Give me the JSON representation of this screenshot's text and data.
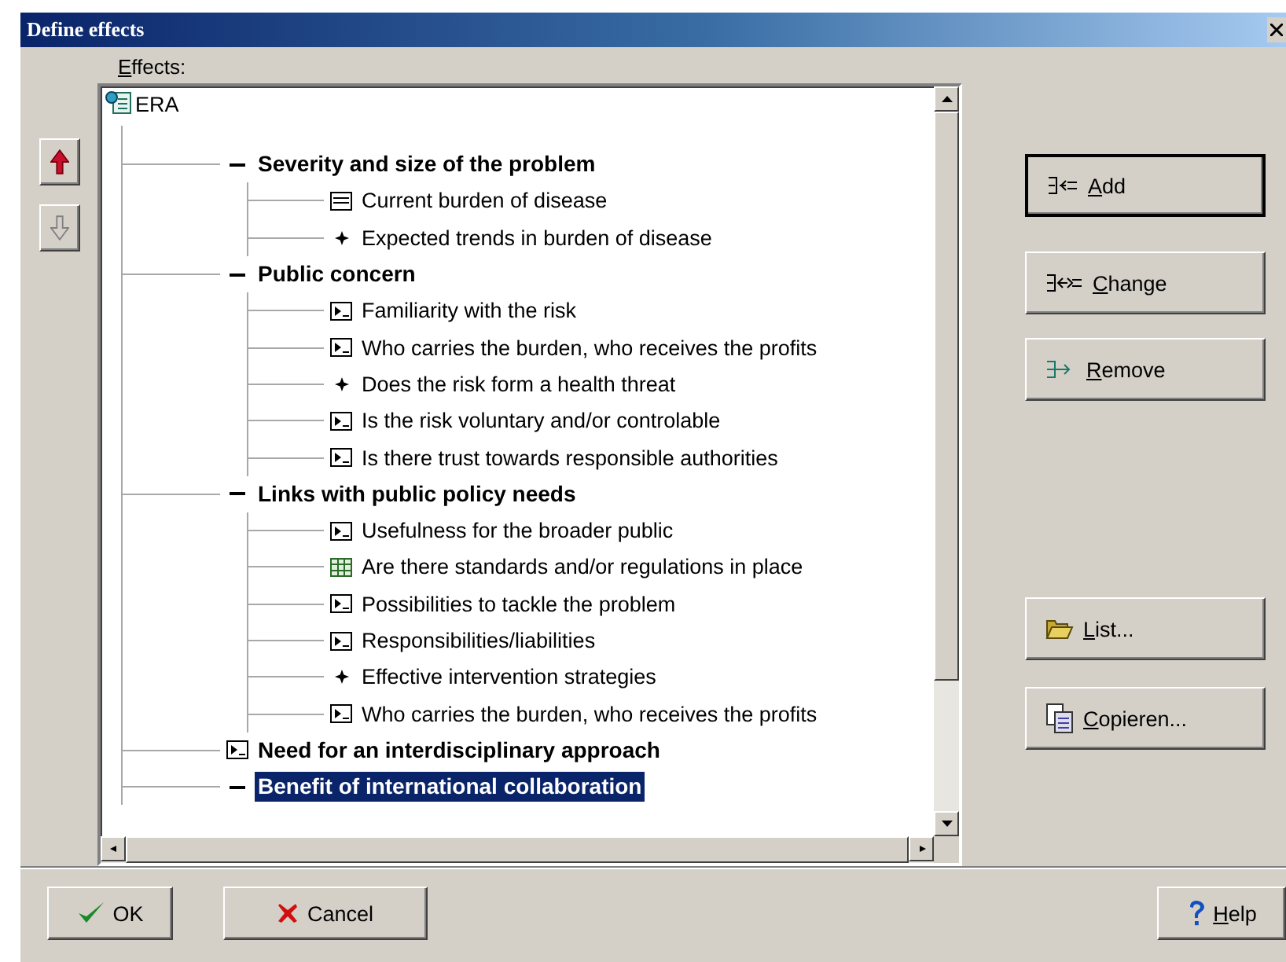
{
  "window": {
    "title": "Define effects"
  },
  "effects_label": "Effects:",
  "move_buttons": [
    {
      "kind": "up",
      "disabled": false
    },
    {
      "kind": "down",
      "disabled": true
    }
  ],
  "tree": {
    "label": "ERA",
    "selected": false,
    "children": [
      {
        "label": "Severity and size of the problem",
        "kind": "group",
        "expanded": true,
        "selected": false,
        "children": [
          {
            "label": "Current burden of disease",
            "kind": "note",
            "selected": false
          },
          {
            "label": "Expected trends in burden of disease",
            "kind": "star",
            "selected": false
          }
        ]
      },
      {
        "label": "Public concern",
        "kind": "group",
        "expanded": true,
        "selected": false,
        "children": [
          {
            "label": "Familiarity with the risk",
            "kind": "document",
            "selected": false
          },
          {
            "label": "Who carries the burden, who receives the profits",
            "kind": "document",
            "selected": false
          },
          {
            "label": "Does the risk form a health threat",
            "kind": "star",
            "selected": false
          },
          {
            "label": "Is the risk voluntary and/or controlable",
            "kind": "document",
            "selected": false
          },
          {
            "label": "Is there trust towards responsible authorities",
            "kind": "document",
            "selected": false
          }
        ]
      },
      {
        "label": "Links with public policy needs",
        "kind": "group",
        "expanded": true,
        "selected": false,
        "children": [
          {
            "label": "Usefulness for the broader public",
            "kind": "document",
            "selected": false
          },
          {
            "label": "Are there standards and/or regulations in place",
            "kind": "table",
            "selected": false
          },
          {
            "label": "Possibilities to tackle the problem",
            "kind": "document",
            "selected": false
          },
          {
            "label": "Responsibilities/liabilities",
            "kind": "document",
            "selected": false
          },
          {
            "label": "Effective intervention strategies",
            "kind": "star",
            "selected": false
          },
          {
            "label": "Who carries the burden, who receives the profits",
            "kind": "document",
            "selected": false
          }
        ]
      },
      {
        "label": "Need for an interdisciplinary approach",
        "kind": "document",
        "selected": false
      },
      {
        "label": "Benefit of international collaboration",
        "kind": "group",
        "expanded": true,
        "selected": true
      }
    ]
  },
  "side_buttons": [
    {
      "label": "Add",
      "kind": "add",
      "default": true
    },
    {
      "label": "Change",
      "kind": "change",
      "default": false
    },
    {
      "label": "Remove",
      "kind": "remove",
      "default": false
    },
    {
      "label": "List...",
      "kind": "list",
      "default": false
    },
    {
      "label": "Copieren...",
      "kind": "copy",
      "default": false
    }
  ],
  "footer_buttons": [
    {
      "label": "OK",
      "kind": "ok"
    },
    {
      "label": "Cancel",
      "kind": "cancel"
    },
    {
      "label": "Help",
      "kind": "help"
    }
  ]
}
